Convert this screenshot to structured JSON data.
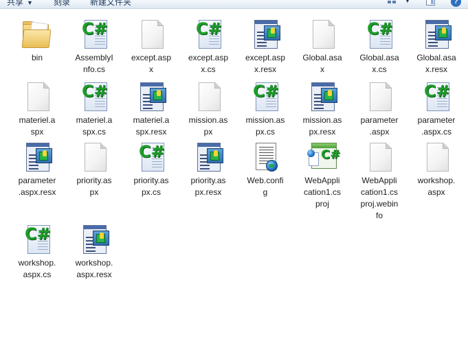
{
  "toolbar": {
    "share_label": "共享",
    "burn_label": "刻录",
    "new_folder_label": "新建文件夹",
    "share_arrow_icon": "chevron-down-icon",
    "view_icon": "view-options-icon",
    "preview_pane_icon": "preview-pane-icon",
    "help_label": "?"
  },
  "colors": {
    "toolbar_text": "#1e395b",
    "cs_glyph": "#1f9d2a",
    "folder": "#e2b64c"
  },
  "files": [
    {
      "name": "bin",
      "type": "folder"
    },
    {
      "name": "AssemblyInfo.cs",
      "type": "cs"
    },
    {
      "name": "except.aspx",
      "type": "aspx"
    },
    {
      "name": "except.aspx.cs",
      "type": "cs"
    },
    {
      "name": "except.aspx.resx",
      "type": "resx"
    },
    {
      "name": "Global.asax",
      "type": "aspx"
    },
    {
      "name": "Global.asax.cs",
      "type": "cs"
    },
    {
      "name": "Global.asax.resx",
      "type": "resx"
    },
    {
      "name": "materiel.aspx",
      "type": "aspx"
    },
    {
      "name": "materiel.aspx.cs",
      "type": "cs"
    },
    {
      "name": "materiel.aspx.resx",
      "type": "resx"
    },
    {
      "name": "mission.aspx",
      "type": "aspx"
    },
    {
      "name": "mission.aspx.cs",
      "type": "cs"
    },
    {
      "name": "mission.aspx.resx",
      "type": "resx"
    },
    {
      "name": "parameter.aspx",
      "type": "aspx"
    },
    {
      "name": "parameter.aspx.cs",
      "type": "cs"
    },
    {
      "name": "parameter.aspx.resx",
      "type": "resx"
    },
    {
      "name": "priority.aspx",
      "type": "aspx"
    },
    {
      "name": "priority.aspx.cs",
      "type": "cs"
    },
    {
      "name": "priority.aspx.resx",
      "type": "resx"
    },
    {
      "name": "Web.config",
      "type": "config"
    },
    {
      "name": "WebApplication1.csproj",
      "type": "csproj"
    },
    {
      "name": "WebApplication1.csproj.webinfo",
      "type": "aspx"
    },
    {
      "name": "workshop.aspx",
      "type": "aspx"
    },
    {
      "name": "workshop.aspx.cs",
      "type": "cs"
    },
    {
      "name": "workshop.aspx.resx",
      "type": "resx"
    }
  ],
  "icons": {
    "folder": "folder-icon",
    "cs": "csharp-file-icon",
    "aspx": "blank-document-icon",
    "resx": "resource-file-icon",
    "config": "config-file-icon",
    "csproj": "csharp-project-icon"
  },
  "labels": [
    [
      "bin"
    ],
    [
      "AssemblyI",
      "nfo.cs"
    ],
    [
      "except.asp",
      "x"
    ],
    [
      "except.asp",
      "x.cs"
    ],
    [
      "except.asp",
      "x.resx"
    ],
    [
      "Global.asa",
      "x"
    ],
    [
      "Global.asa",
      "x.cs"
    ],
    [
      "Global.asa",
      "x.resx"
    ],
    [
      "materiel.a",
      "spx"
    ],
    [
      "materiel.a",
      "spx.cs"
    ],
    [
      "materiel.a",
      "spx.resx"
    ],
    [
      "mission.as",
      "px"
    ],
    [
      "mission.as",
      "px.cs"
    ],
    [
      "mission.as",
      "px.resx"
    ],
    [
      "parameter",
      ".aspx"
    ],
    [
      "parameter",
      ".aspx.cs"
    ],
    [
      "parameter",
      ".aspx.resx"
    ],
    [
      "priority.as",
      "px"
    ],
    [
      "priority.as",
      "px.cs"
    ],
    [
      "priority.as",
      "px.resx"
    ],
    [
      "Web.confi",
      "g"
    ],
    [
      "WebAppli",
      "cation1.cs",
      "proj"
    ],
    [
      "WebAppli",
      "cation1.cs",
      "proj.webin",
      "fo"
    ],
    [
      "workshop.",
      "aspx"
    ],
    [
      "workshop.",
      "aspx.cs"
    ],
    [
      "workshop.",
      "aspx.resx"
    ]
  ]
}
